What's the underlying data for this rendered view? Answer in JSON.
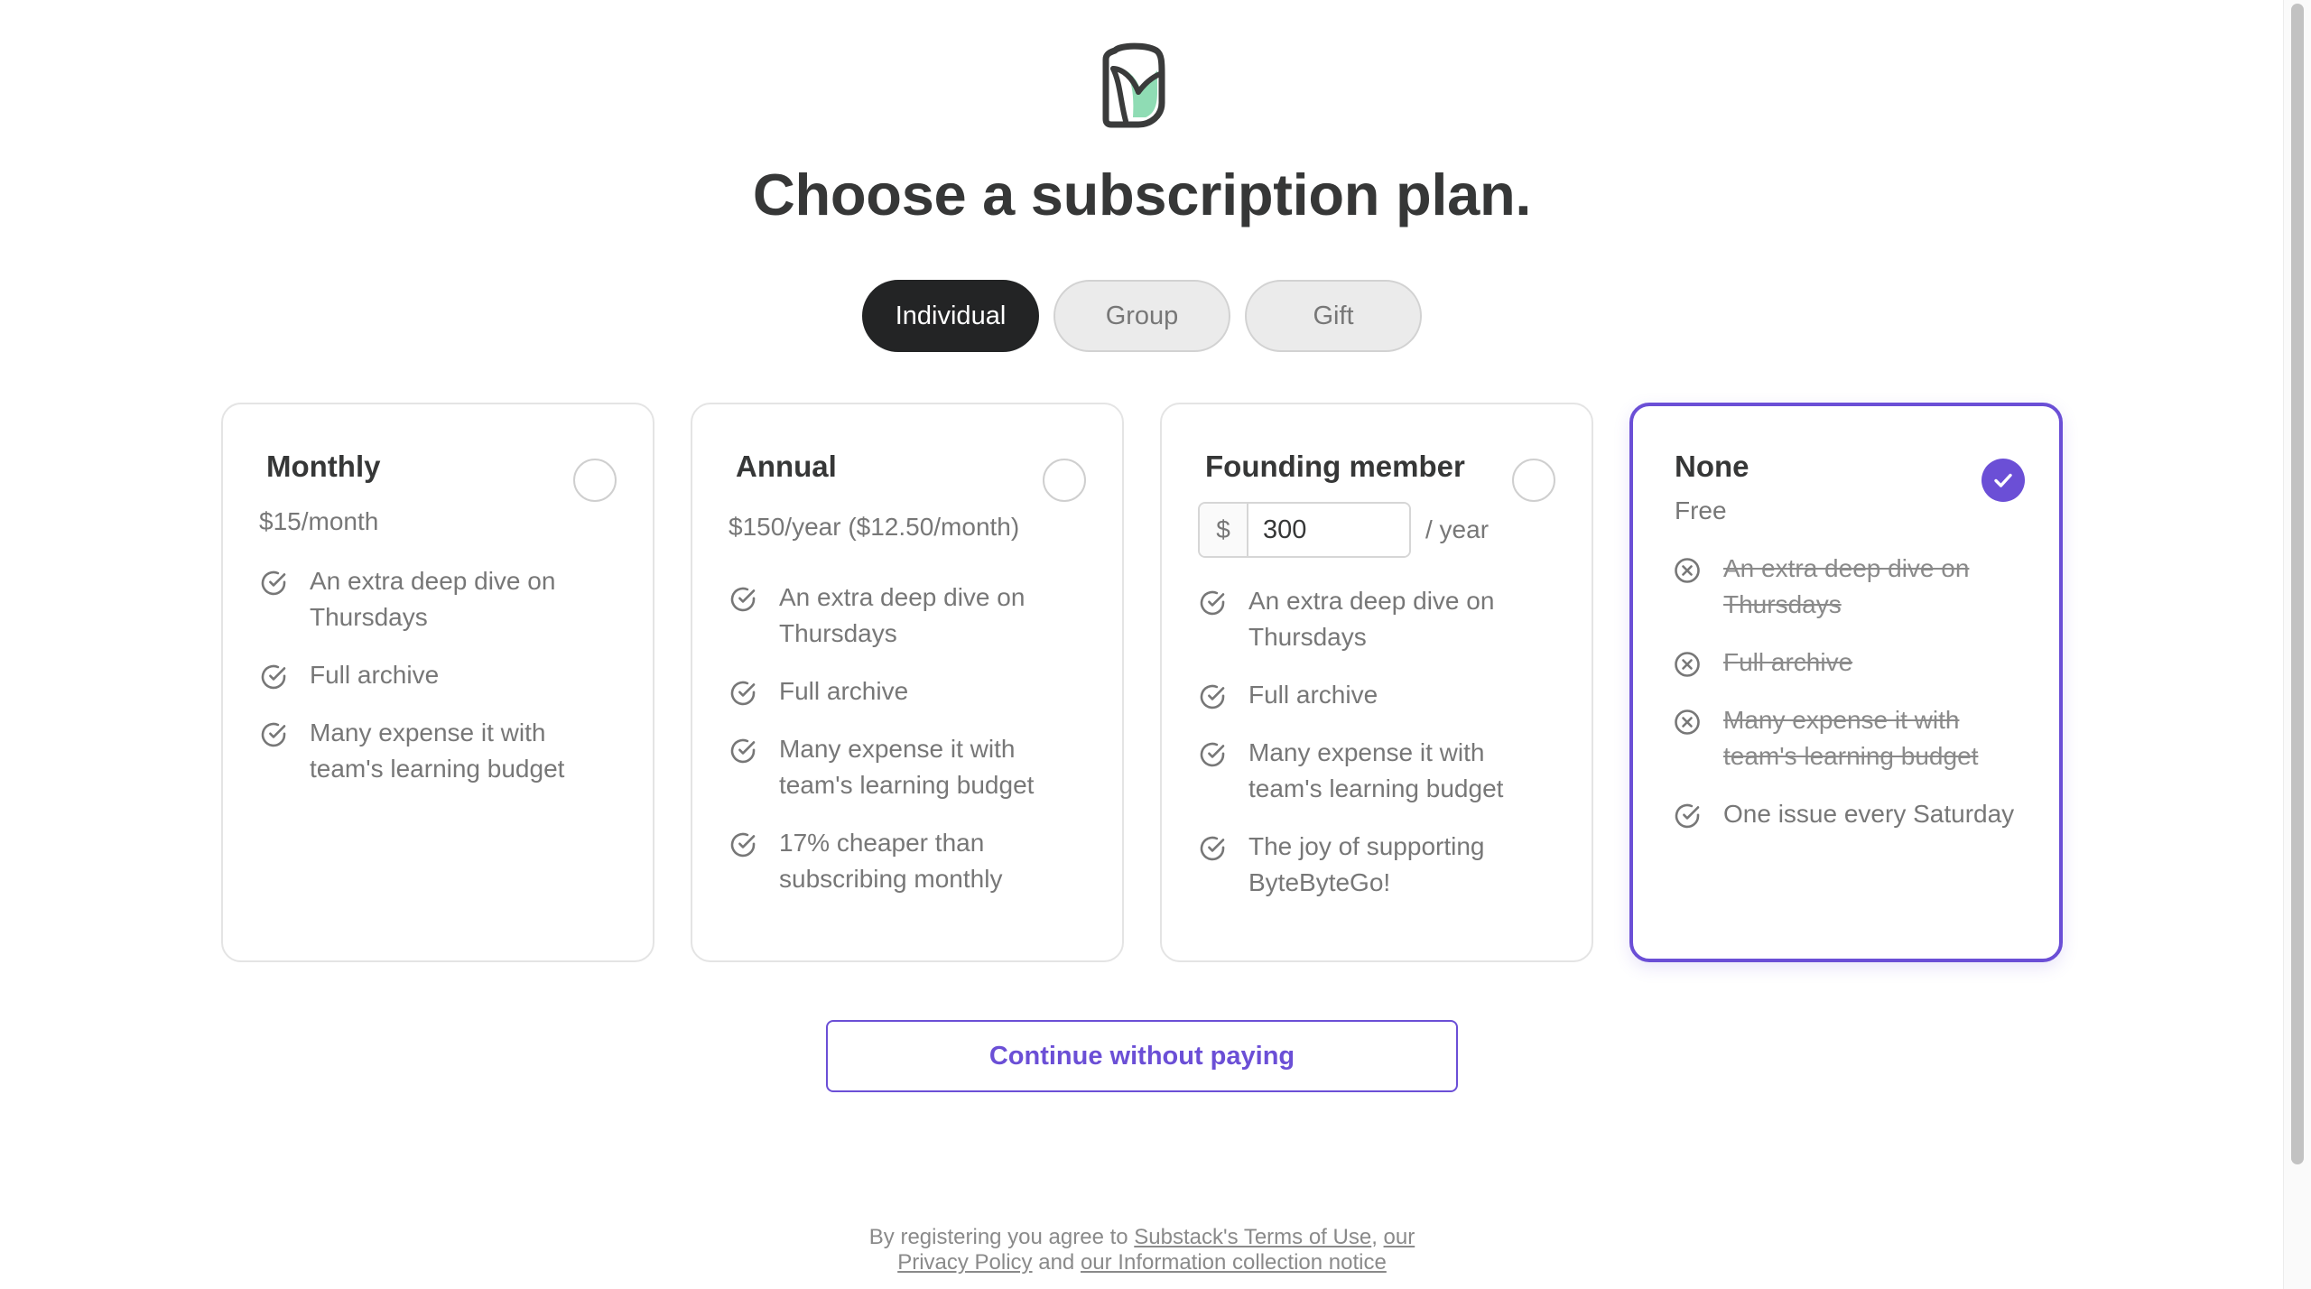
{
  "heading": "Choose a subscription plan.",
  "tabs": [
    {
      "label": "Individual",
      "active": true
    },
    {
      "label": "Group",
      "active": false
    },
    {
      "label": "Gift",
      "active": false
    }
  ],
  "plans": [
    {
      "name": "Monthly",
      "price": "$15/month",
      "selected": false,
      "features": [
        {
          "text": "An extra deep dive on Thursdays",
          "included": true
        },
        {
          "text": "Full archive",
          "included": true
        },
        {
          "text": "Many expense it with team's learning budget",
          "included": true
        }
      ]
    },
    {
      "name": "Annual",
      "price": "$150/year ($12.50/month)",
      "selected": false,
      "features": [
        {
          "text": "An extra deep dive on Thursdays",
          "included": true
        },
        {
          "text": "Full archive",
          "included": true
        },
        {
          "text": "Many expense it with team's learning budget",
          "included": true
        },
        {
          "text": "17% cheaper than subscribing monthly",
          "included": true
        }
      ]
    },
    {
      "name": "Founding member",
      "currency_symbol": "$",
      "amount": "300",
      "period": "/ year",
      "selected": false,
      "features": [
        {
          "text": "An extra deep dive on Thursdays",
          "included": true
        },
        {
          "text": "Full archive",
          "included": true
        },
        {
          "text": "Many expense it with team's learning budget",
          "included": true
        },
        {
          "text": "The joy of supporting ByteByteGo!",
          "included": true
        }
      ]
    },
    {
      "name": "None",
      "price": "Free",
      "selected": true,
      "features": [
        {
          "text": "An extra deep dive on Thursdays",
          "included": false
        },
        {
          "text": "Full archive",
          "included": false
        },
        {
          "text": "Many expense it with team's learning budget",
          "included": false
        },
        {
          "text": "One issue every Saturday",
          "included": true
        }
      ]
    }
  ],
  "continue_button": "Continue without paying",
  "legal": {
    "prefix": "By registering you agree to",
    "terms_link": "Substack's Terms of Use",
    "comma": ",",
    "our": "our",
    "privacy_link": "Privacy Policy",
    "and": "and",
    "info_link": "our Information collection notice"
  },
  "colors": {
    "accent": "#6b4fd6",
    "logo_green": "#8fdcb4",
    "logo_outline": "#3a3b3b",
    "text_dark": "#363737",
    "text_muted": "#777777"
  },
  "icons": {
    "included": "check-circle-icon",
    "excluded": "x-circle-icon",
    "selected": "checkmark-icon",
    "logo": "substack-leaf-logo"
  }
}
